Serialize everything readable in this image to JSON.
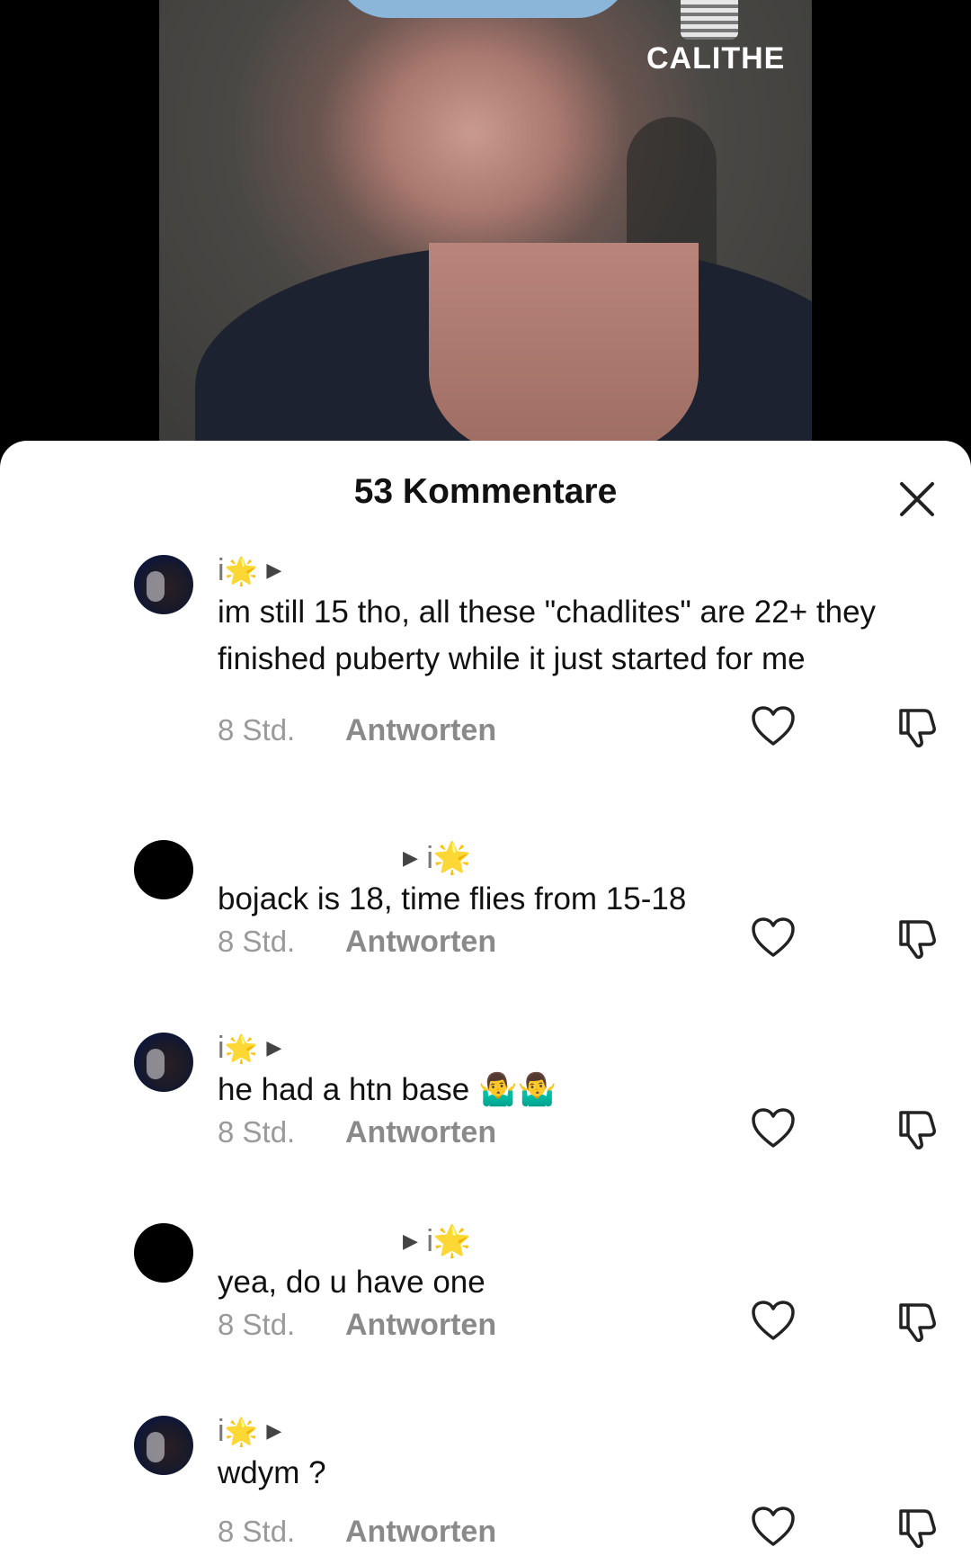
{
  "video": {
    "brand_logo_text": "CALITHE"
  },
  "sheet": {
    "title": "53 Kommentare",
    "close_icon": "close-icon"
  },
  "comments": [
    {
      "username_prefix": "i",
      "username_emoji": "🌟",
      "reply_to": "",
      "avatar": "photo",
      "text": "im still 15 tho, all these \"chadlites\" are 22+ they finished puberty while it just started for me",
      "time": "8 Std.",
      "reply_label": "Antworten"
    },
    {
      "username_prefix": "",
      "username_emoji": "",
      "reply_to": "i🌟",
      "avatar": "black",
      "text": "bojack is 18, time flies from 15-18",
      "time": "8 Std.",
      "reply_label": "Antworten"
    },
    {
      "username_prefix": "i",
      "username_emoji": "🌟",
      "reply_to": "",
      "avatar": "photo",
      "text": "he had a htn base 🤷‍♂️🤷‍♂️",
      "time": "8 Std.",
      "reply_label": "Antworten"
    },
    {
      "username_prefix": "",
      "username_emoji": "",
      "reply_to": "i🌟",
      "avatar": "black",
      "text": "yea, do u have one",
      "time": "8 Std.",
      "reply_label": "Antworten"
    },
    {
      "username_prefix": "i",
      "username_emoji": "🌟",
      "reply_to": "",
      "avatar": "photo",
      "text": "wdym ?",
      "time": "8 Std.",
      "reply_label": "Antworten"
    }
  ]
}
